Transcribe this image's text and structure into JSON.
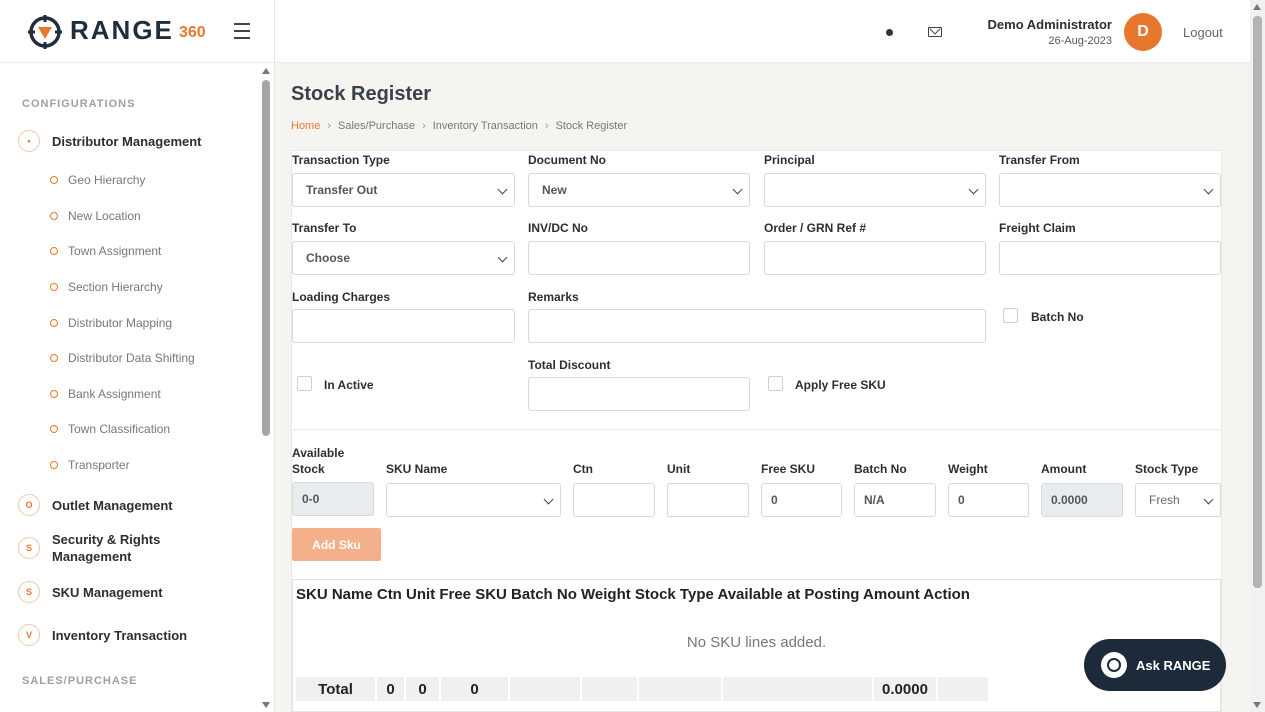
{
  "brand": {
    "name": "RANGE",
    "suffix": "360"
  },
  "header": {
    "user_name": "Demo Administrator",
    "date": "26-Aug-2023",
    "avatar_initial": "D",
    "logout": "Logout"
  },
  "sidebar": {
    "section_config": "CONFIGURATIONS",
    "section_sales": "SALES/PURCHASE",
    "groups": [
      {
        "badge": "•",
        "label": "Distributor Management"
      },
      {
        "badge": "O",
        "label": "Outlet Management"
      },
      {
        "badge": "S",
        "label": "Security & Rights Management"
      },
      {
        "badge": "S",
        "label": "SKU Management"
      },
      {
        "badge": "V",
        "label": "Inventory Transaction"
      }
    ],
    "sub_items": [
      "Geo Hierarchy",
      "New Location",
      "Town Assignment",
      "Section Hierarchy",
      "Distributor Mapping",
      "Distributor Data Shifting",
      "Bank Assignment",
      "Town Classification",
      "Transporter"
    ]
  },
  "page": {
    "title": "Stock Register",
    "breadcrumb": [
      "Home",
      "Sales/Purchase",
      "Inventory Transaction",
      "Stock Register"
    ]
  },
  "form": {
    "transaction_type": {
      "label": "Transaction Type",
      "value": "Transfer Out"
    },
    "document_no": {
      "label": "Document No",
      "value": "New"
    },
    "principal": {
      "label": "Principal",
      "value": ""
    },
    "transfer_from": {
      "label": "Transfer From",
      "value": ""
    },
    "transfer_to": {
      "label": "Transfer To",
      "value": "Choose"
    },
    "inv_dc_no": {
      "label": "INV/DC No",
      "value": ""
    },
    "order_grn_ref": {
      "label": "Order / GRN Ref #",
      "value": ""
    },
    "freight_claim": {
      "label": "Freight Claim",
      "value": ""
    },
    "loading_charges": {
      "label": "Loading Charges",
      "value": ""
    },
    "remarks": {
      "label": "Remarks",
      "value": ""
    },
    "batch_no_check": "Batch No",
    "in_active_check": "In Active",
    "total_discount": {
      "label": "Total Discount",
      "value": ""
    },
    "apply_free_sku_check": "Apply Free SKU"
  },
  "sku_entry": {
    "available_stock": {
      "label_line1": "Available",
      "label_line2": "Stock",
      "value": "0-0"
    },
    "sku_name": {
      "label": "SKU Name",
      "value": ""
    },
    "ctn": {
      "label": "Ctn",
      "value": ""
    },
    "unit": {
      "label": "Unit",
      "value": ""
    },
    "free_sku": {
      "label": "Free SKU",
      "value": "0"
    },
    "batch_no": {
      "label": "Batch No",
      "value": "N/A"
    },
    "weight": {
      "label": "Weight",
      "value": "0"
    },
    "amount": {
      "label": "Amount",
      "value": "0.0000"
    },
    "stock_type": {
      "label": "Stock Type",
      "value": "Fresh"
    },
    "add_button": "Add Sku"
  },
  "sku_table": {
    "header": "SKU Name Ctn Unit Free SKU Batch No Weight Stock Type Available at Posting Amount Action",
    "empty_message": "No SKU lines added.",
    "total_label": "Total",
    "total_ctn": "0",
    "total_unit": "0",
    "total_free": "0",
    "total_amount": "0.0000"
  },
  "assistant": {
    "label": "Ask RANGE"
  },
  "colors": {
    "accent": "#e8772e",
    "navy": "#1d2a3a"
  }
}
